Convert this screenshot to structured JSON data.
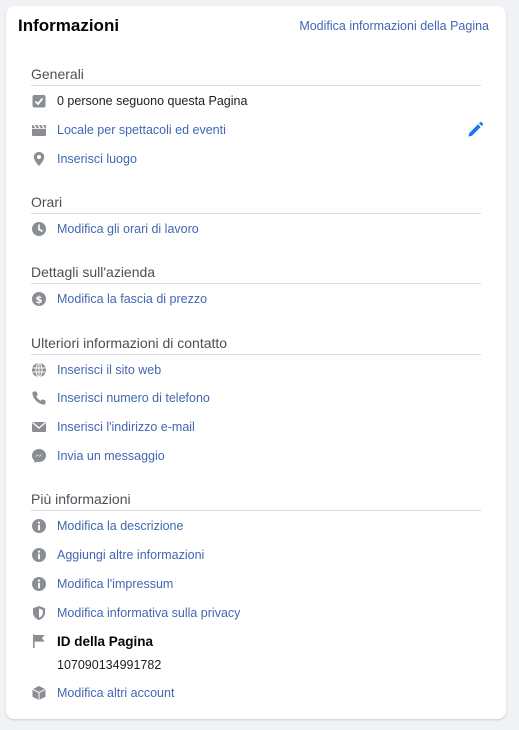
{
  "card": {
    "title": "Informazioni",
    "edit_link": "Modifica informazioni della Pagina"
  },
  "sections": {
    "generali": {
      "header": "Generali",
      "followers": "0 persone seguono questa Pagina",
      "category": "Locale per spettacoli ed eventi",
      "location": "Inserisci luogo"
    },
    "orari": {
      "header": "Orari",
      "hours": "Modifica gli orari di lavoro"
    },
    "azienda": {
      "header": "Dettagli sull'azienda",
      "price": "Modifica la fascia di prezzo"
    },
    "contatti": {
      "header": "Ulteriori informazioni di contatto",
      "website": "Inserisci il sito web",
      "phone": "Inserisci numero di telefono",
      "email": "Inserisci l'indirizzo e-mail",
      "message": "Invia un messaggio"
    },
    "altro": {
      "header": "Più informazioni",
      "description": "Modifica la descrizione",
      "more_info": "Aggiungi altre informazioni",
      "impressum": "Modifica l'impressum",
      "privacy": "Modifica informativa sulla privacy",
      "page_id_label": "ID della Pagina",
      "page_id_value": "107090134991782",
      "other_accounts": "Modifica altri account"
    }
  },
  "colors": {
    "link": "#4267b2",
    "icon_gray": "#8a8d91",
    "pencil_blue": "#1877f2",
    "divider": "#dadde1"
  }
}
